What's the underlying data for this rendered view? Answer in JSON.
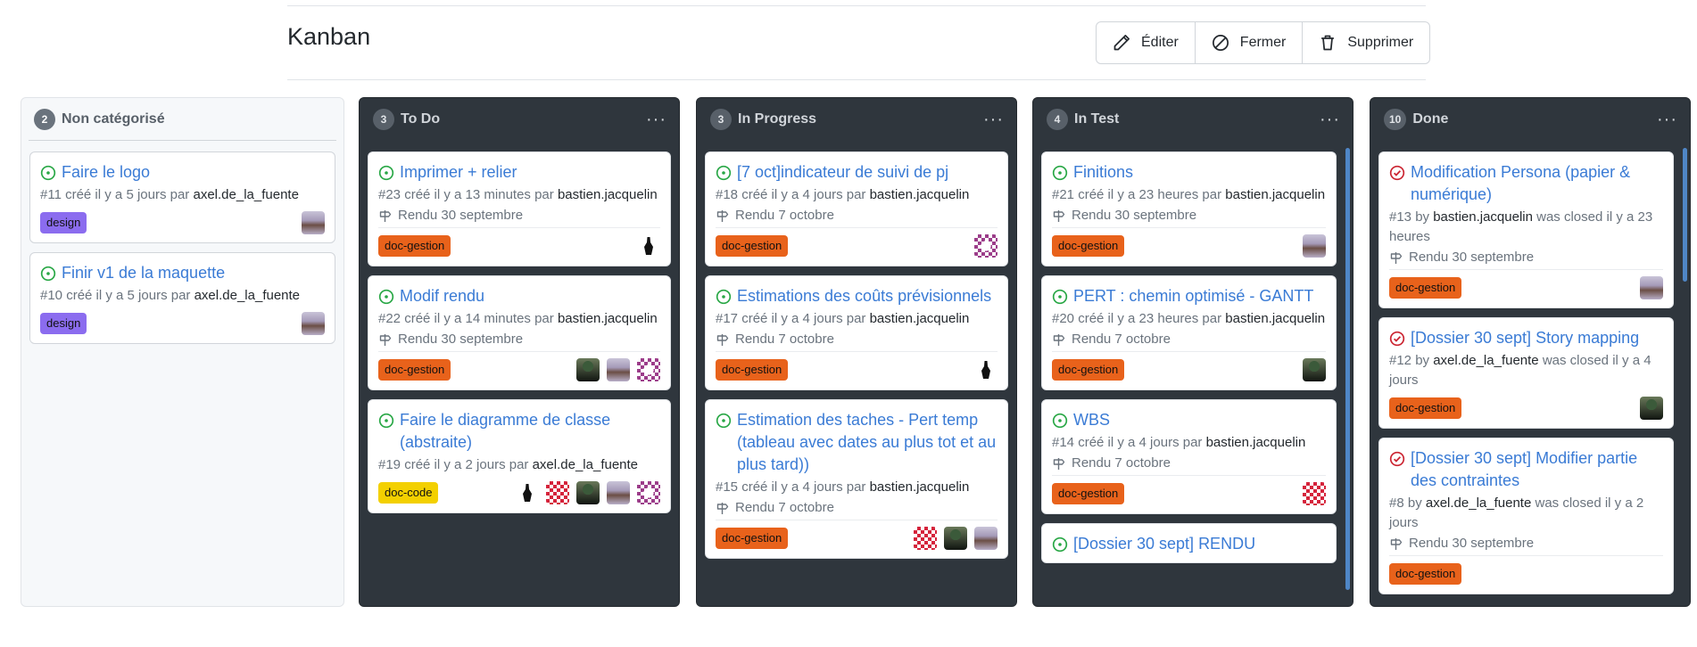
{
  "board": {
    "title": "Kanban",
    "actions": {
      "edit": "Éditer",
      "close": "Fermer",
      "delete": "Supprimer"
    }
  },
  "columns": [
    {
      "name": "Non catégorisé",
      "count": "2",
      "cards": [
        {
          "title": "Faire le logo",
          "meta_prefix": "#11 créé il y a 5 jours par ",
          "user": "axel.de_la_fuente",
          "label": "design",
          "label_style": "design",
          "avatars": [
            "photo"
          ]
        },
        {
          "title": "Finir v1 de la maquette",
          "meta_prefix": "#10 créé il y a 5 jours par ",
          "user": "axel.de_la_fuente",
          "label": "design",
          "label_style": "design",
          "avatars": [
            "photo"
          ]
        }
      ]
    },
    {
      "name": "To Do",
      "count": "3",
      "cards": [
        {
          "title": "Imprimer + relier",
          "meta_prefix": "#23 créé il y a 13 minutes par ",
          "user": "bastien.jacquelin",
          "milestone": "Rendu 30 septembre",
          "label": "doc-gestion",
          "label_style": "gestion",
          "avatars": [
            "knight"
          ]
        },
        {
          "title": "Modif rendu",
          "meta_prefix": "#22 créé il y a 14 minutes par ",
          "user": "bastien.jacquelin",
          "milestone": "Rendu 30 septembre",
          "label": "doc-gestion",
          "label_style": "gestion",
          "avatars": [
            "dark",
            "photo",
            "purple"
          ]
        },
        {
          "title": "Faire le diagramme de classe (abstraite)",
          "meta_prefix": "#19 créé il y a 2 jours par ",
          "user": "axel.de_la_fuente",
          "label": "doc-code",
          "label_style": "code",
          "avatars": [
            "knight",
            "red",
            "dark",
            "photo",
            "purple"
          ]
        }
      ]
    },
    {
      "name": "In Progress",
      "count": "3",
      "cards": [
        {
          "title": "[7 oct]indicateur de suivi de pj",
          "meta_prefix": "#18 créé il y a 4 jours par ",
          "user": "bastien.jacquelin",
          "milestone": "Rendu 7 octobre",
          "label": "doc-gestion",
          "label_style": "gestion",
          "avatars": [
            "purple"
          ]
        },
        {
          "title": "Estimations des coûts prévisionnels",
          "meta_prefix": "#17 créé il y a 4 jours par ",
          "user": "bastien.jacquelin",
          "milestone": "Rendu 7 octobre",
          "label": "doc-gestion",
          "label_style": "gestion",
          "avatars": [
            "knight"
          ]
        },
        {
          "title": "Estimation des taches - Pert temp (tableau avec dates au plus tot et au plus tard))",
          "meta_prefix": "#15 créé il y a 4 jours par ",
          "user": "bastien.jacquelin",
          "milestone": "Rendu 7 octobre",
          "label": "doc-gestion",
          "label_style": "gestion",
          "avatars": [
            "red",
            "dark",
            "photo"
          ]
        }
      ]
    },
    {
      "name": "In Test",
      "count": "4",
      "cards": [
        {
          "title": "Finitions",
          "meta_prefix": "#21 créé il y a 23 heures par ",
          "user": "bastien.jacquelin",
          "milestone": "Rendu 30 septembre",
          "label": "doc-gestion",
          "label_style": "gestion",
          "avatars": [
            "photo"
          ]
        },
        {
          "title": "PERT : chemin optimisé - GANTT",
          "meta_prefix": "#20 créé il y a 23 heures par ",
          "user": "bastien.jacquelin",
          "milestone": "Rendu 7 octobre",
          "label": "doc-gestion",
          "label_style": "gestion",
          "avatars": [
            "dark"
          ]
        },
        {
          "title": "WBS",
          "meta_prefix": "#14 créé il y a 4 jours par ",
          "user": "bastien.jacquelin",
          "milestone": "Rendu 7 octobre",
          "label": "doc-gestion",
          "label_style": "gestion",
          "avatars": [
            "red"
          ]
        },
        {
          "title": "[Dossier 30 sept] RENDU",
          "meta_prefix": "",
          "user": "",
          "label": "",
          "label_style": "gestion",
          "avatars": []
        }
      ]
    },
    {
      "name": "Done",
      "count": "10",
      "cards": [
        {
          "title": "Modification Persona (papier & numérique)",
          "closed": true,
          "meta_prefix": "#13 by ",
          "user": "bastien.jacquelin",
          "meta_suffix": " was closed il y a 23 heures",
          "milestone": "Rendu 30 septembre",
          "label": "doc-gestion",
          "label_style": "gestion",
          "avatars": [
            "photo"
          ]
        },
        {
          "title": "[Dossier 30 sept] Story mapping",
          "closed": true,
          "meta_prefix": "#12 by ",
          "user": "axel.de_la_fuente",
          "meta_suffix": " was closed il y a 4 jours",
          "label": "doc-gestion",
          "label_style": "gestion",
          "avatars": [
            "dark"
          ]
        },
        {
          "title": "[Dossier 30 sept] Modifier partie des contraintes",
          "closed": true,
          "meta_prefix": "#8 by ",
          "user": "axel.de_la_fuente",
          "meta_suffix": " was closed il y a 2 jours",
          "milestone": "Rendu 30 septembre",
          "label": "doc-gestion",
          "label_style": "gestion",
          "avatars": []
        }
      ]
    }
  ],
  "colors": {
    "open_icon": "#28a745",
    "closed_icon": "#cb2431",
    "title_link": "#3a7bd5",
    "dark_column": "#2f363d"
  }
}
